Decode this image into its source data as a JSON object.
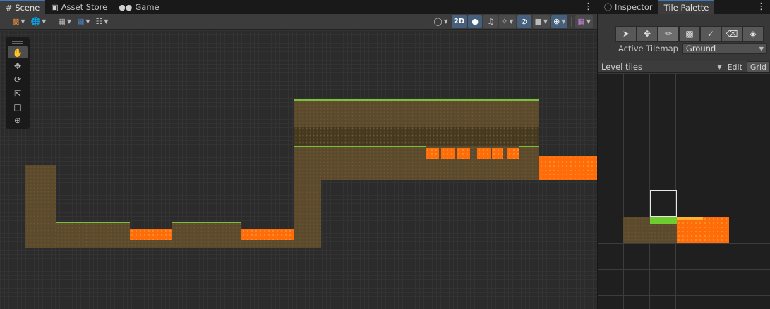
{
  "scene_panel": {
    "tabs": [
      {
        "label": "Scene",
        "icon": "grid-icon"
      },
      {
        "label": "Asset Store",
        "icon": "bag-icon"
      },
      {
        "label": "Game",
        "icon": "gamepad-icon"
      }
    ],
    "toolbar": {
      "mode_2d_label": "2D"
    },
    "tools": [
      "hand-tool",
      "move-tool",
      "rotate-tool",
      "scale-tool",
      "rect-tool",
      "transform-tool"
    ]
  },
  "palette_panel": {
    "tabs": [
      {
        "label": "Inspector",
        "icon": "info-icon"
      },
      {
        "label": "Tile Palette"
      }
    ],
    "active_tilemap_label": "Active Tilemap",
    "active_tilemap_value": "Ground",
    "palette_name": "Level tiles",
    "edit_label": "Edit",
    "grid_label": "Grid"
  },
  "colors": {
    "accent": "#3a79bb",
    "dirt": "#5c4a2c",
    "grass": "#78c23a",
    "lava": "#ff6d0b"
  }
}
